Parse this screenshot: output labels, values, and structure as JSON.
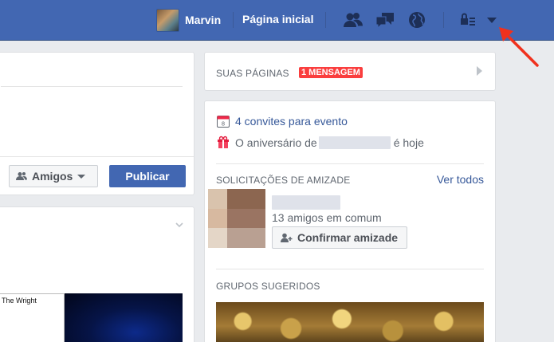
{
  "topbar": {
    "user_name": "Marvin",
    "home_label": "Página inicial",
    "icons": [
      "friends-icon",
      "messages-icon",
      "globe-icon",
      "privacy-shortcuts-icon",
      "account-menu-caret-icon"
    ],
    "brand_color": "#4267b2"
  },
  "composer": {
    "audience_label": "Amigos",
    "publish_label": "Publicar"
  },
  "post": {
    "thumbnail_text": "The Wright"
  },
  "pages": {
    "title": "SUAS PÁGINAS",
    "badge": "1 MENSAGEM",
    "badge_color": "#fa3e3e"
  },
  "events": {
    "invites_label": "4 convites para evento",
    "calendar_day": "8",
    "birthday_prefix": "O aniversário de",
    "birthday_suffix": "é hoje"
  },
  "friend_requests": {
    "title": "SOLICITAÇÕES DE AMIZADE",
    "see_all": "Ver todos",
    "mutual": "13 amigos em comum",
    "confirm_label": "Confirmar amizade"
  },
  "groups": {
    "title": "GRUPOS SUGERIDOS"
  }
}
